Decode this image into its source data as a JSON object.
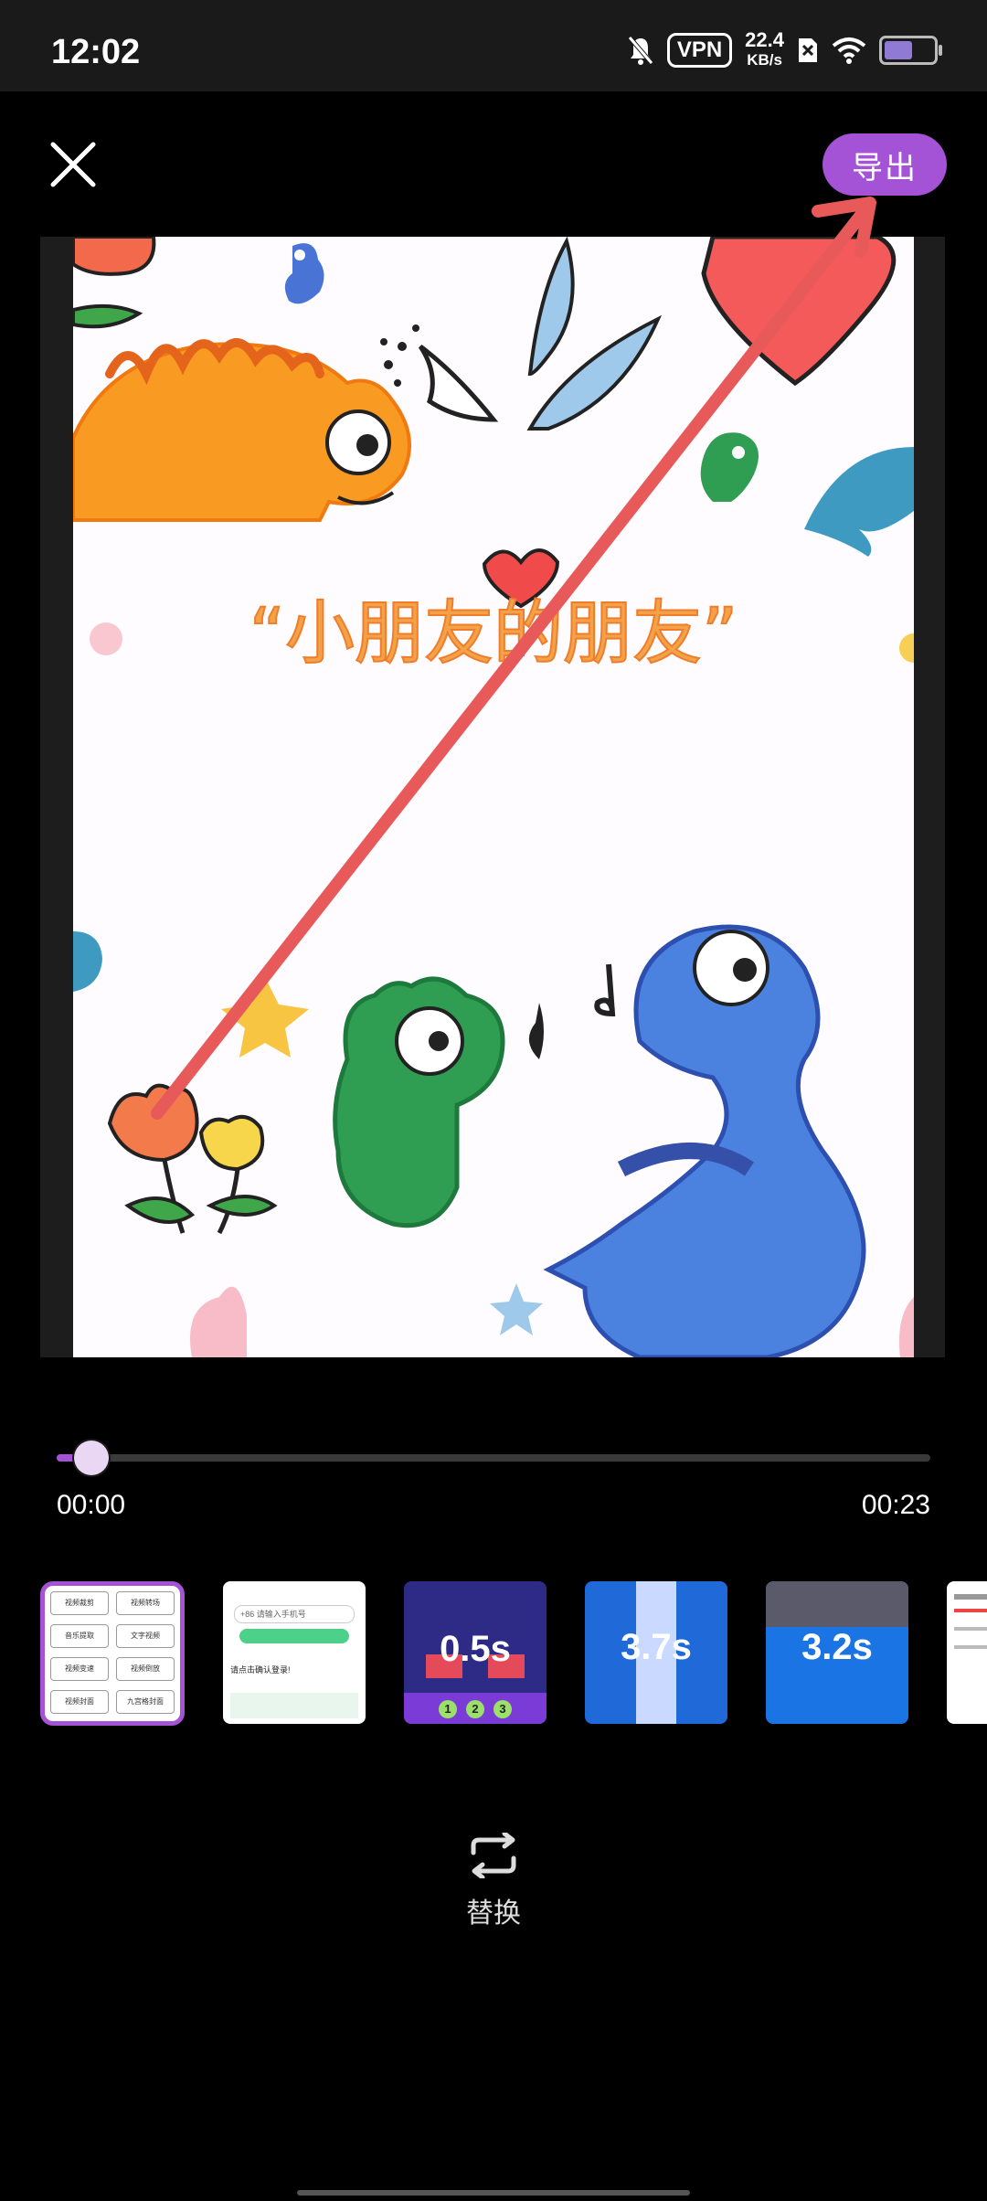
{
  "status_bar": {
    "time": "12:02",
    "vpn": "VPN",
    "speed_value": "22.4",
    "speed_unit": "KB/s"
  },
  "header": {
    "export_label": "导出"
  },
  "preview": {
    "title_text": "“小朋友的朋友”"
  },
  "playback": {
    "current_time": "00:00",
    "total_time": "00:23",
    "progress": 0.04
  },
  "thumbnails": [
    {
      "kind": "menu",
      "selected": true,
      "items": [
        "视频裁剪",
        "视频转场",
        "音乐提取",
        "文字视频",
        "视频变速",
        "视频倒放",
        "视频封面",
        "九宫格封面"
      ]
    },
    {
      "kind": "phone-login",
      "placeholder": "+86 请输入手机号",
      "line1": "请点击确认登录!"
    },
    {
      "kind": "game",
      "caption": "0.5s",
      "steps": [
        "1",
        "2",
        "3"
      ]
    },
    {
      "kind": "game",
      "caption": "3.7s"
    },
    {
      "kind": "game",
      "caption": "3.2s"
    },
    {
      "kind": "doc"
    }
  ],
  "actions": {
    "replace_label": "替换"
  },
  "colors": {
    "accent": "#a452d6",
    "annotation_arrow": "#e85a5a"
  }
}
